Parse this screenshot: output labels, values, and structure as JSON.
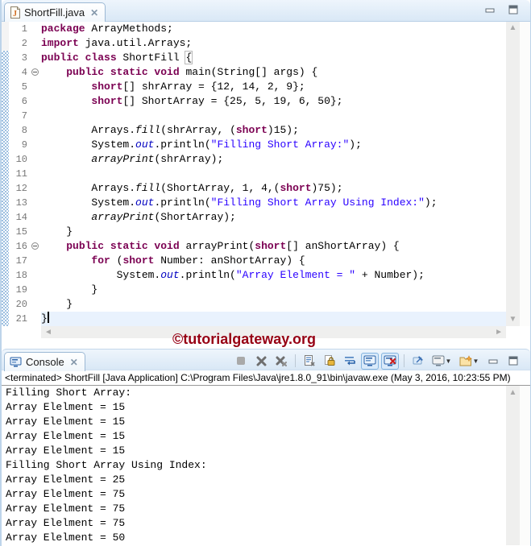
{
  "colors": {
    "keyword": "#7B0052",
    "string": "#2A00FF",
    "static_field": "#0000C0",
    "watermark": "#970014",
    "console_icon_blue": "#2a62a8",
    "error_red": "#cc1f1f"
  },
  "editor_tab": {
    "title": "ShortFill.java",
    "close_glyph": "✕"
  },
  "watermark_text": "©tutorialgateway.org",
  "editor": {
    "lines": [
      {
        "n": "1",
        "tokens": [
          {
            "c": "kw",
            "t": "package"
          },
          {
            "c": "pl",
            "t": " ArrayMethods;"
          }
        ]
      },
      {
        "n": "2",
        "tokens": [
          {
            "c": "kw",
            "t": "import"
          },
          {
            "c": "pl",
            "t": " java.util.Arrays;"
          }
        ]
      },
      {
        "n": "3",
        "tokens": [
          {
            "c": "kw",
            "t": "public class"
          },
          {
            "c": "pl",
            "t": " ShortFill "
          },
          {
            "c": "brk",
            "t": "{"
          }
        ]
      },
      {
        "n": "4",
        "fold": true,
        "tokens": [
          {
            "c": "pl",
            "t": "    "
          },
          {
            "c": "kw",
            "t": "public static void"
          },
          {
            "c": "pl",
            "t": " main(String[] args) {"
          }
        ]
      },
      {
        "n": "5",
        "tokens": [
          {
            "c": "pl",
            "t": "        "
          },
          {
            "c": "kw",
            "t": "short"
          },
          {
            "c": "pl",
            "t": "[] shrArray = {12, 14, 2, 9};"
          }
        ]
      },
      {
        "n": "6",
        "tokens": [
          {
            "c": "pl",
            "t": "        "
          },
          {
            "c": "kw",
            "t": "short"
          },
          {
            "c": "pl",
            "t": "[] ShortArray = {25, 5, 19, 6, 50};"
          }
        ]
      },
      {
        "n": "7",
        "tokens": []
      },
      {
        "n": "8",
        "tokens": [
          {
            "c": "pl",
            "t": "        Arrays."
          },
          {
            "c": "sm",
            "t": "fill"
          },
          {
            "c": "pl",
            "t": "(shrArray, ("
          },
          {
            "c": "kw",
            "t": "short"
          },
          {
            "c": "pl",
            "t": ")15);"
          }
        ]
      },
      {
        "n": "9",
        "tokens": [
          {
            "c": "pl",
            "t": "        System."
          },
          {
            "c": "sf",
            "t": "out"
          },
          {
            "c": "pl",
            "t": ".println("
          },
          {
            "c": "str",
            "t": "\"Filling Short Array:\""
          },
          {
            "c": "pl",
            "t": ");"
          }
        ]
      },
      {
        "n": "10",
        "tokens": [
          {
            "c": "pl",
            "t": "        "
          },
          {
            "c": "sm",
            "t": "arrayPrint"
          },
          {
            "c": "pl",
            "t": "(shrArray);"
          }
        ]
      },
      {
        "n": "11",
        "tokens": []
      },
      {
        "n": "12",
        "tokens": [
          {
            "c": "pl",
            "t": "        Arrays."
          },
          {
            "c": "sm",
            "t": "fill"
          },
          {
            "c": "pl",
            "t": "(ShortArray, 1, 4,("
          },
          {
            "c": "kw",
            "t": "short"
          },
          {
            "c": "pl",
            "t": ")75);"
          }
        ]
      },
      {
        "n": "13",
        "tokens": [
          {
            "c": "pl",
            "t": "        System."
          },
          {
            "c": "sf",
            "t": "out"
          },
          {
            "c": "pl",
            "t": ".println("
          },
          {
            "c": "str",
            "t": "\"Filling Short Array Using Index:\""
          },
          {
            "c": "pl",
            "t": ");"
          }
        ]
      },
      {
        "n": "14",
        "tokens": [
          {
            "c": "pl",
            "t": "        "
          },
          {
            "c": "sm",
            "t": "arrayPrint"
          },
          {
            "c": "pl",
            "t": "(ShortArray);"
          }
        ]
      },
      {
        "n": "15",
        "tokens": [
          {
            "c": "pl",
            "t": "    }"
          }
        ]
      },
      {
        "n": "16",
        "fold": true,
        "tokens": [
          {
            "c": "pl",
            "t": "    "
          },
          {
            "c": "kw",
            "t": "public static void"
          },
          {
            "c": "pl",
            "t": " arrayPrint("
          },
          {
            "c": "kw",
            "t": "short"
          },
          {
            "c": "pl",
            "t": "[] anShortArray) {"
          }
        ]
      },
      {
        "n": "17",
        "tokens": [
          {
            "c": "pl",
            "t": "        "
          },
          {
            "c": "kw",
            "t": "for"
          },
          {
            "c": "pl",
            "t": " ("
          },
          {
            "c": "kw",
            "t": "short"
          },
          {
            "c": "pl",
            "t": " Number: anShortArray) {"
          }
        ]
      },
      {
        "n": "18",
        "tokens": [
          {
            "c": "pl",
            "t": "            System."
          },
          {
            "c": "sf",
            "t": "out"
          },
          {
            "c": "pl",
            "t": ".println("
          },
          {
            "c": "str",
            "t": "\"Array Elelment = \""
          },
          {
            "c": "pl",
            "t": " + Number);"
          }
        ]
      },
      {
        "n": "19",
        "tokens": [
          {
            "c": "pl",
            "t": "        }"
          }
        ]
      },
      {
        "n": "20",
        "tokens": [
          {
            "c": "pl",
            "t": "    }"
          }
        ]
      },
      {
        "n": "21",
        "current": true,
        "caret": true,
        "tokens": [
          {
            "c": "pl",
            "t": "}"
          }
        ]
      }
    ]
  },
  "console": {
    "tab_label": "Console",
    "tab_close_glyph": "✕",
    "status_line": "<terminated> ShortFill [Java Application] C:\\Program Files\\Java\\jre1.8.0_91\\bin\\javaw.exe (May 3, 2016, 10:23:55 PM)",
    "output_lines": [
      "Filling Short Array:",
      "Array Elelment = 15",
      "Array Elelment = 15",
      "Array Elelment = 15",
      "Array Elelment = 15",
      "Filling Short Array Using Index:",
      "Array Elelment = 25",
      "Array Elelment = 75",
      "Array Elelment = 75",
      "Array Elelment = 75",
      "Array Elelment = 50"
    ],
    "toolbar_icons": [
      "terminate-icon",
      "remove-launch-icon",
      "remove-all-terminated-icon",
      "clear-console-icon",
      "scroll-lock-icon",
      "word-wrap-icon",
      "show-stdout-icon",
      "show-stderr-icon",
      "pin-console-icon",
      "display-selected-console-icon",
      "open-console-icon",
      "minimize-icon",
      "maximize-icon"
    ]
  }
}
